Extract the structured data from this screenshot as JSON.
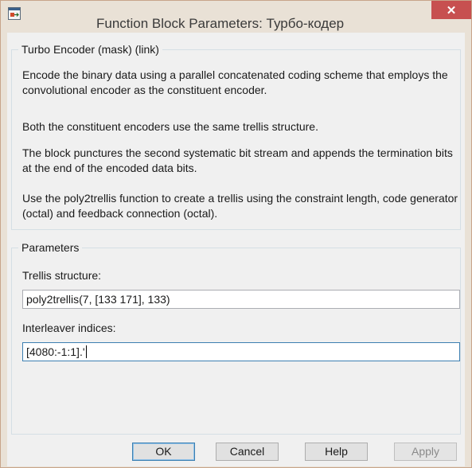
{
  "window": {
    "title": "Function Block Parameters: Турбо-кодер",
    "close_label": "✕",
    "colors": {
      "frame": "#e9e1d6",
      "close": "#c75050",
      "focus": "#3c7fb1"
    }
  },
  "description": {
    "group_title": "Turbo Encoder (mask) (link)",
    "paragraphs": [
      "Encode the binary data using a parallel concatenated coding scheme that employs the convolutional encoder as the constituent encoder.",
      "Both the constituent encoders use the same trellis structure.",
      "The block punctures the second systematic bit stream and appends the termination bits at the end of the encoded data bits.",
      "Use the poly2trellis function to create a trellis using the constraint length, code generator (octal) and feedback connection (octal)."
    ]
  },
  "parameters": {
    "group_title": "Parameters",
    "trellis_label": "Trellis structure:",
    "trellis_value": "poly2trellis(7, [133 171], 133)",
    "interleaver_label": "Interleaver indices:",
    "interleaver_value": "[4080:-1:1].'"
  },
  "buttons": {
    "ok": "OK",
    "cancel": "Cancel",
    "help": "Help",
    "apply": "Apply"
  }
}
